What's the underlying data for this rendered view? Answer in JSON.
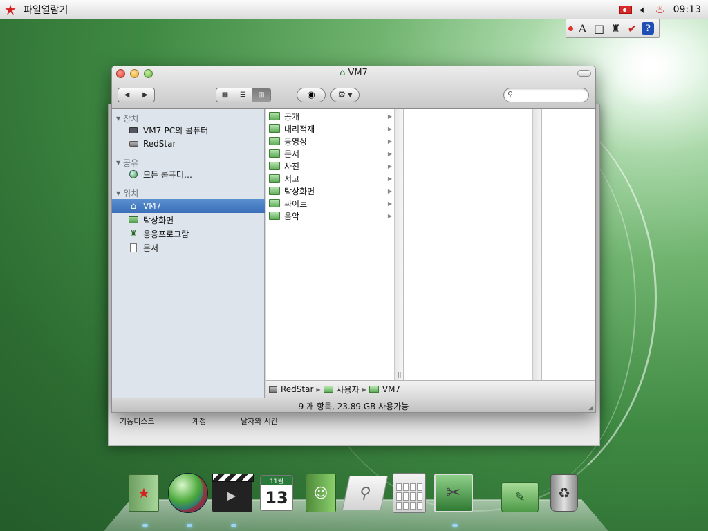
{
  "menubar": {
    "app_name": "파일열람기",
    "time": "09:13"
  },
  "input_bar": {
    "buttons": [
      "A",
      "",
      "",
      "",
      "?"
    ]
  },
  "background_window": {
    "labels": [
      "기동디스크",
      "계정",
      "날자와 시간"
    ]
  },
  "window": {
    "title": "VM7",
    "search_placeholder": ""
  },
  "sidebar": {
    "sections": [
      {
        "label": "장치",
        "items": [
          {
            "label": "VM7-PC의 콤퓨터",
            "icon": "monitor-icon"
          },
          {
            "label": "RedStar",
            "icon": "drive-icon"
          }
        ]
      },
      {
        "label": "공유",
        "items": [
          {
            "label": "모든 콤퓨터…",
            "icon": "network-globe-icon"
          }
        ]
      },
      {
        "label": "위치",
        "items": [
          {
            "label": "VM7",
            "icon": "home-icon",
            "selected": true
          },
          {
            "label": "탁상화면",
            "icon": "desktop-icon"
          },
          {
            "label": "응용프로그람",
            "icon": "applications-icon"
          },
          {
            "label": "문서",
            "icon": "document-icon"
          }
        ]
      }
    ]
  },
  "columns": {
    "first": [
      "공개",
      "내리적재",
      "동영상",
      "문서",
      "사진",
      "서고",
      "탁상화면",
      "싸이트",
      "음악"
    ]
  },
  "pathbar": {
    "items": [
      "RedStar",
      "사용자",
      "VM7"
    ]
  },
  "status": {
    "text": "9 개 항목, 23.89 GB 사용가능"
  },
  "dock": {
    "calendar_month": "11월",
    "calendar_day": "13",
    "items": [
      "book-icon",
      "globe-browser-icon",
      "video-clapper-icon",
      "calendar-icon",
      "contacts-icon",
      "search-icon",
      "calculator-icon",
      "system-preferences-icon",
      "folder-icon",
      "trash-icon"
    ]
  },
  "colors": {
    "selection": "#3b6fb8",
    "accent_green": "#2f7a33",
    "star_red": "#d81f1f"
  }
}
